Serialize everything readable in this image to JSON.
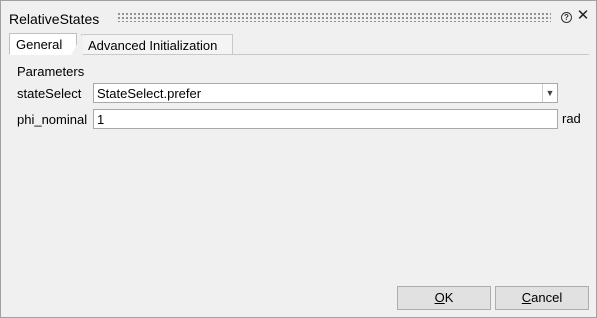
{
  "window": {
    "title": "RelativeStates"
  },
  "tabs": [
    {
      "label": "General",
      "active": true
    },
    {
      "label": "Advanced Initialization",
      "active": false
    }
  ],
  "parameters": {
    "group_label": "Parameters",
    "stateSelect": {
      "label": "stateSelect",
      "value": "StateSelect.prefer"
    },
    "phi_nominal": {
      "label": "phi_nominal",
      "value": "1",
      "unit": "rad"
    }
  },
  "buttons": {
    "ok": {
      "mnemonic": "O",
      "rest": "K"
    },
    "cancel": {
      "mnemonic": "C",
      "rest": "ancel"
    }
  },
  "icons": {
    "help": "help-icon",
    "close": "close-icon",
    "dropdown": "chevron-down-icon"
  }
}
